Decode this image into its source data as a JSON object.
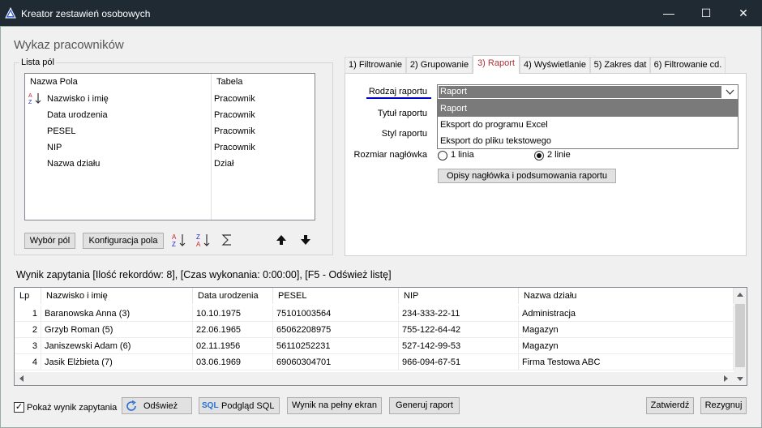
{
  "window": {
    "title": "Kreator zestawień osobowych",
    "minimize": "—",
    "maximize": "☐",
    "close": "✕"
  },
  "heading": "Wykaz pracowników",
  "fields_group": {
    "legend": "Lista pól",
    "columns": [
      "Nazwa Pola",
      "Tabela"
    ],
    "rows": [
      {
        "name": "Nazwisko i imię",
        "table": "Pracownik"
      },
      {
        "name": "Data urodzenia",
        "table": "Pracownik"
      },
      {
        "name": "PESEL",
        "table": "Pracownik"
      },
      {
        "name": "NIP",
        "table": "Pracownik"
      },
      {
        "name": "Nazwa działu",
        "table": "Dział"
      }
    ],
    "buttons": {
      "select_fields": "Wybór pól",
      "config_field": "Konfiguracja pola"
    }
  },
  "tabs": [
    {
      "label": "1) Filtrowanie"
    },
    {
      "label": "2) Grupowanie"
    },
    {
      "label": "3) Raport"
    },
    {
      "label": "4) Wyświetlanie"
    },
    {
      "label": "5) Zakres dat"
    },
    {
      "label": "6) Filtrowanie cd."
    }
  ],
  "report_tab": {
    "report_type_label": "Rodzaj raportu",
    "report_type_value": "Raport",
    "report_type_options": [
      "Raport",
      "Eksport do programu Excel",
      "Eksport do pliku tekstowego"
    ],
    "report_title_label": "Tytuł raportu",
    "report_style_label": "Styl raportu",
    "header_size_label": "Rozmiar nagłówka",
    "header_size_options": [
      "1 linia",
      "2 linie"
    ],
    "header_size_selected": "2 linie",
    "descriptions_button": "Opisy nagłówka i podsumowania raportu"
  },
  "result_info": "Wynik zapytania [Ilość rekordów: 8], [Czas wykonania:  0:00:00], [F5 - Odśwież listę]",
  "result_table": {
    "columns": [
      "Lp",
      "Nazwisko i imię",
      "Data urodzenia",
      "PESEL",
      "NIP",
      "Nazwa działu"
    ],
    "rows": [
      [
        "1",
        "Baranowska Anna (3)",
        "10.10.1975",
        "75101003564",
        "234-333-22-11",
        "Administracja"
      ],
      [
        "2",
        "Grzyb Roman (5)",
        "22.06.1965",
        "65062208975",
        "755-122-64-42",
        "Magazyn"
      ],
      [
        "3",
        "Janiszewski Adam (6)",
        "02.11.1956",
        "56110252231",
        "527-142-99-53",
        "Magazyn"
      ],
      [
        "4",
        "Jasik Elżbieta (7)",
        "03.06.1969",
        "69060304701",
        "966-094-67-51",
        "Firma Testowa ABC"
      ]
    ]
  },
  "bottom": {
    "show_result_label": "Pokaż wynik zapytania",
    "show_result_checked": true,
    "refresh": "Odśwież",
    "sql_preview": "Podgląd SQL",
    "sql_tag": "SQL",
    "fullscreen": "Wynik na pełny ekran",
    "generate": "Generuj raport",
    "confirm": "Zatwierdź",
    "cancel": "Rezygnuj"
  },
  "colors": {
    "titlebar": "#202a33",
    "active_tab_text": "#aa3333",
    "underline": "#0000cc",
    "selected_item": "#7a7a7a"
  }
}
